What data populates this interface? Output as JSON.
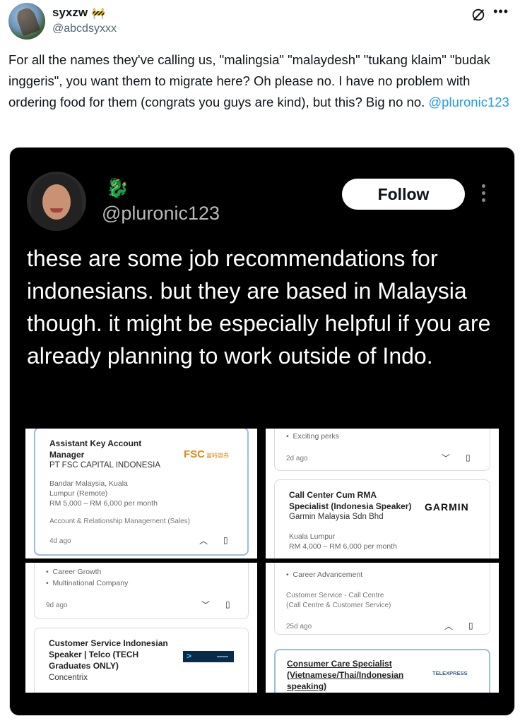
{
  "post": {
    "author_name": "syxzw",
    "author_badge": "🚧",
    "author_handle": "@abcdsyxxx",
    "text_before": "For all the names they've calling us, \"malingsia\" \"malaydesh\" \"tukang klaim\" \"budak inggeris\", you want them to migrate here? Oh please no. I have no problem with ordering food for them (congrats you guys are kind), but this? Big no no. ",
    "mention": "@pluronic123"
  },
  "embedded": {
    "handle": "@pluronic123",
    "follow_label": "Follow",
    "text": "these are some job recommendations for indonesians. but they are based in Malaysia though. it might be especially helpful if you are already planning to work outside of Indo."
  },
  "jobs": {
    "tile1": {
      "title_l1": "Assistant Key Account",
      "title_l2": "Manager",
      "company": "PT FSC CAPITAL INDONESIA",
      "logo": "FSC",
      "logo_sub": "富時證券",
      "loc_l1": "Bandar Malaysia, Kuala",
      "loc_l2": "Lumpur (Remote)",
      "salary": "RM 5,000 – RM 6,000 per month",
      "category": "Account & Relationship Management (Sales)",
      "age": "4d ago"
    },
    "tile2": {
      "perk": "Exciting perks",
      "age": "2d ago",
      "title_l1": "Call Center Cum RMA",
      "title_l2": "Specialist (Indonesia Speaker)",
      "company": "Garmin Malaysia Sdn Bhd",
      "logo": "GARMIN",
      "location": "Kuala Lumpur",
      "salary": "RM 4,000 – RM 6,000 per month"
    },
    "tile3": {
      "bullet1": "Career Growth",
      "bullet2": "Multinational Company",
      "age": "9d ago",
      "title_l1": "Customer Service Indonesian",
      "title_l2": "Speaker | Telco (TECH",
      "title_l3": "Graduates ONLY)",
      "company": "Concentrix"
    },
    "tile4": {
      "bullet1": "Career Advancement",
      "category_l1": "Customer Service - Call Centre",
      "category_l2": "(Call Centre & Customer Service)",
      "age": "25d ago",
      "title_l1": "Consumer Care Specialist",
      "title_l2": "(Vietnamese/Thai/Indonesian",
      "title_l3": "speaking)",
      "logo": "TELEXPRESS"
    }
  },
  "colors": {
    "link": "#1d9bf0",
    "media_bg": "#000000",
    "follow_bg": "#ffffff"
  }
}
